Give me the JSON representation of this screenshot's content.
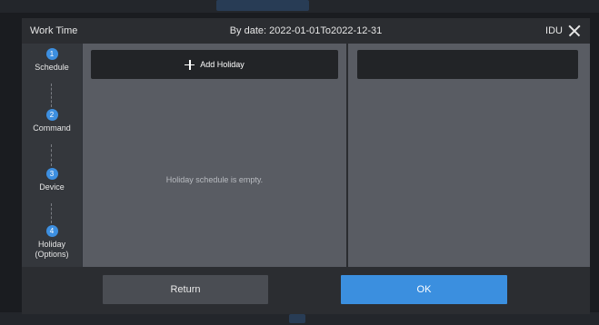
{
  "header": {
    "title": "Work Time",
    "date_range": "By date: 2022-01-01To2022-12-31",
    "unit": "IDU"
  },
  "steps": [
    {
      "number": "1",
      "label": "Schedule"
    },
    {
      "number": "2",
      "label": "Command"
    },
    {
      "number": "3",
      "label": "Device"
    },
    {
      "number": "4",
      "label": "Holiday\n(Options)"
    }
  ],
  "holiday": {
    "add_label": "Add Holiday",
    "empty_message": "Holiday schedule is empty."
  },
  "footer": {
    "return_label": "Return",
    "ok_label": "OK"
  },
  "colors": {
    "accent": "#3b8fdf",
    "panel": "#595c63",
    "dialog_bg": "#2f3238"
  }
}
